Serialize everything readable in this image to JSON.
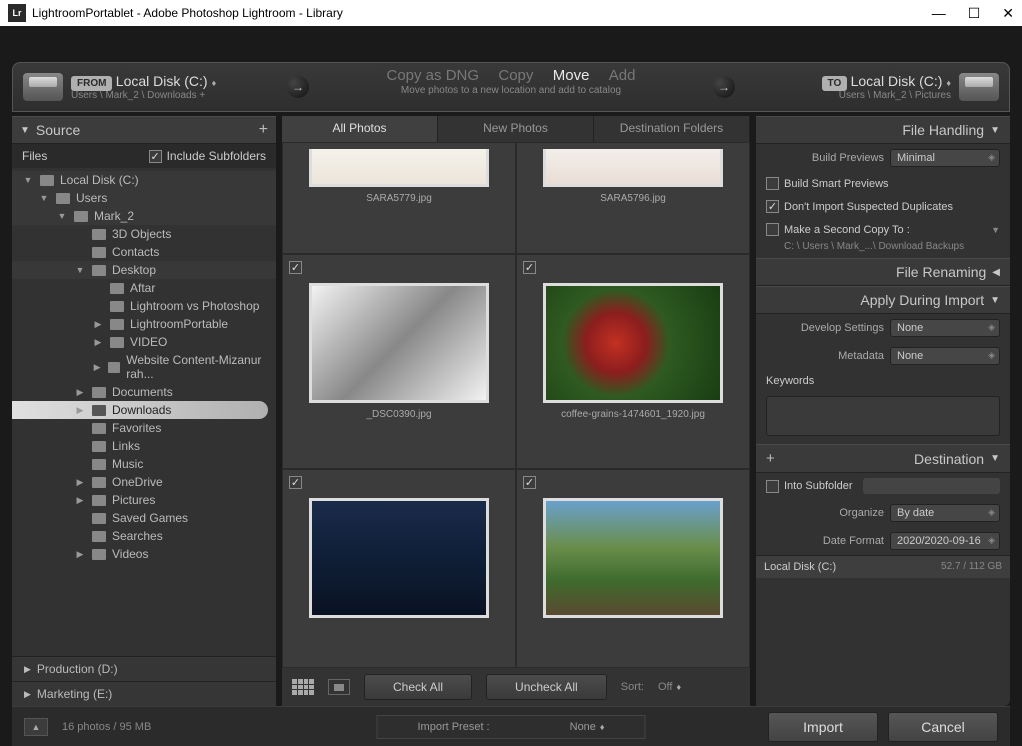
{
  "window": {
    "title": "LightroomPortablet - Adobe Photoshop Lightroom - Library",
    "app_icon_label": "Lr"
  },
  "import_bar": {
    "from_badge": "FROM",
    "to_badge": "TO",
    "from_disk": "Local Disk (C:)",
    "to_disk": "Local Disk (C:)",
    "from_path": "Users \\ Mark_2 \\ Downloads +",
    "to_path": "Users \\ Mark_2 \\ Pictures",
    "actions": {
      "copy_dng": "Copy as DNG",
      "copy": "Copy",
      "move": "Move",
      "add": "Add"
    },
    "subtitle": "Move photos to a new location and add to catalog"
  },
  "source_panel": {
    "header": "Source",
    "files_label": "Files",
    "include_subfolders_label": "Include Subfolders",
    "tree": [
      {
        "label": "Local Disk (C:)",
        "depth": 0,
        "header": true,
        "arrow": "▼"
      },
      {
        "label": "Users",
        "depth": 1,
        "header": true,
        "arrow": "▼"
      },
      {
        "label": "Mark_2",
        "depth": 2,
        "header": true,
        "arrow": "▼"
      },
      {
        "label": "3D Objects",
        "depth": 3
      },
      {
        "label": "Contacts",
        "depth": 3
      },
      {
        "label": "Desktop",
        "depth": 3,
        "arrow": "▼",
        "header": true
      },
      {
        "label": "Aftar",
        "depth": 4
      },
      {
        "label": "Lightroom vs Photoshop",
        "depth": 4
      },
      {
        "label": "LightroomPortable",
        "depth": 4,
        "arrow": "▶"
      },
      {
        "label": "VIDEO",
        "depth": 4,
        "arrow": "▶"
      },
      {
        "label": "Website Content-Mizanur rah...",
        "depth": 4,
        "arrow": "▶"
      },
      {
        "label": "Documents",
        "depth": 3,
        "arrow": "▶"
      },
      {
        "label": "Downloads",
        "depth": 3,
        "arrow": "▶",
        "selected": true
      },
      {
        "label": "Favorites",
        "depth": 3
      },
      {
        "label": "Links",
        "depth": 3
      },
      {
        "label": "Music",
        "depth": 3
      },
      {
        "label": "OneDrive",
        "depth": 3,
        "arrow": "▶"
      },
      {
        "label": "Pictures",
        "depth": 3,
        "arrow": "▶"
      },
      {
        "label": "Saved Games",
        "depth": 3
      },
      {
        "label": "Searches",
        "depth": 3
      },
      {
        "label": "Videos",
        "depth": 3,
        "arrow": "▶"
      }
    ],
    "production_label": "Production (D:)",
    "marketing_label": "Marketing (E:)"
  },
  "center": {
    "tabs": {
      "all": "All Photos",
      "new": "New Photos",
      "dest": "Destination Folders"
    },
    "thumbs": [
      {
        "name": "SARA5779.jpg",
        "bg": "linear-gradient(#f5f2ec,#ece5da)"
      },
      {
        "name": "SARA5796.jpg",
        "bg": "linear-gradient(#f3eeea,#e9ded6)"
      },
      {
        "name": "_DSC0390.jpg",
        "bg": "linear-gradient(135deg,#f2f2f2,#888 50%,#f2f2f2)"
      },
      {
        "name": "coffee-grains-1474601_1920.jpg",
        "bg": "radial-gradient(circle at 40% 50%, #c33022 0%, #8c1e1e 25%, #2f5a20 45%, #193d13 100%)"
      },
      {
        "name": "",
        "bg": "linear-gradient(#1a2b4a,#0e1c33 60%,#0a1222)"
      },
      {
        "name": "",
        "bg": "linear-gradient(#6aa0cc 0%,#6a8e4c 40%,#3f6b2e 70%,#5a4a30 100%)"
      }
    ],
    "check_all": "Check All",
    "uncheck_all": "Uncheck All",
    "sort_label": "Sort:",
    "sort_value": "Off"
  },
  "right": {
    "file_handling": {
      "header": "File Handling",
      "build_previews_label": "Build Previews",
      "build_previews_value": "Minimal",
      "build_smart_previews": "Build Smart Previews",
      "dont_import_dupes": "Don't Import Suspected Duplicates",
      "second_copy_label": "Make a Second Copy To :",
      "second_copy_path": "C: \\ Users \\ Mark_...\\ Download Backups"
    },
    "file_renaming_header": "File Renaming",
    "apply_during_import": {
      "header": "Apply During Import",
      "develop_settings_label": "Develop Settings",
      "develop_settings_value": "None",
      "metadata_label": "Metadata",
      "metadata_value": "None",
      "keywords_label": "Keywords"
    },
    "destination": {
      "header": "Destination",
      "into_subfolder": "Into Subfolder",
      "organize_label": "Organize",
      "organize_value": "By date",
      "date_format_label": "Date Format",
      "date_format_value": "2020/2020-09-16",
      "disk_label": "Local Disk (C:)",
      "disk_usage": "52.7 / 112 GB"
    }
  },
  "footer": {
    "count": "16 photos / 95 MB",
    "import_preset_label": "Import Preset :",
    "import_preset_value": "None",
    "import_btn": "Import",
    "cancel_btn": "Cancel"
  }
}
